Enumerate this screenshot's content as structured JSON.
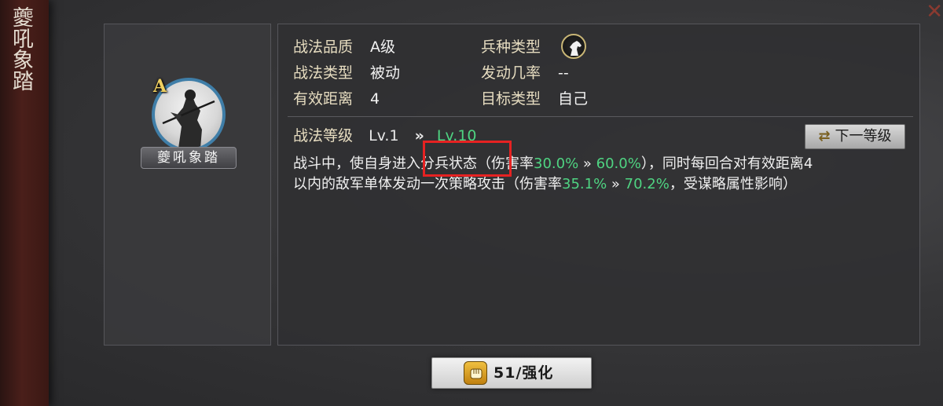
{
  "banner": {
    "title": "夔吼象踏"
  },
  "skill": {
    "grade_badge": "A",
    "name": "夔吼象踏"
  },
  "attributes": {
    "quality_label": "战法品质",
    "quality_value": "A级",
    "type_label": "战法类型",
    "type_value": "被动",
    "range_label": "有效距离",
    "range_value": "4",
    "unit_label": "兵种类型",
    "unit_icon": "horse-icon",
    "chance_label": "发动几率",
    "chance_value": "--",
    "target_label": "目标类型",
    "target_value": "自己"
  },
  "level": {
    "label": "战法等级",
    "current": "Lv.1",
    "arrow": "»",
    "max": "Lv.10",
    "next_button": "下一等级"
  },
  "description": {
    "line1_a": "战斗中，使自身进入分兵状态（伤害率",
    "line1_rate1": "30.0%",
    "line1_arrow": " » ",
    "line1_rate2": "60.0%",
    "line1_b": "），同时每回合对有效距离4",
    "line2_a": "以内的敌军单体发动一次策略攻击（伤害率",
    "line2_rate1": "35.1%",
    "line2_arrow": " » ",
    "line2_rate2": "70.2%",
    "line2_b": "，受谋略属性影响）"
  },
  "upgrade": {
    "label": "51/强化",
    "icon": "fist-icon"
  },
  "colors": {
    "highlight": "#e62222",
    "accent_green": "#4fd482",
    "label_gold": "#e6dcc0"
  }
}
